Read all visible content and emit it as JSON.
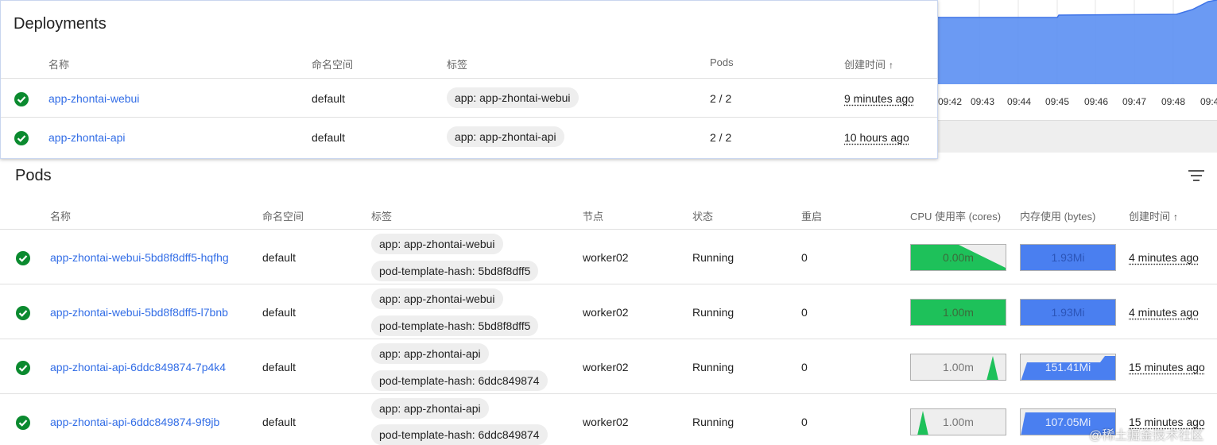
{
  "background_chart": {
    "x_ticks": [
      "09:42",
      "09:43",
      "09:44",
      "09:45",
      "09:46",
      "09:47",
      "09:48",
      "09:4"
    ]
  },
  "deployments": {
    "title": "Deployments",
    "columns": [
      "名称",
      "命名空间",
      "标签",
      "Pods",
      "创建时间"
    ],
    "sort_indicator": "↑",
    "rows": [
      {
        "status": "check-circle-icon",
        "name": "app-zhontai-webui",
        "namespace": "default",
        "label": "app: app-zhontai-webui",
        "pods": "2 / 2",
        "created": "9 minutes ago"
      },
      {
        "status": "check-circle-icon",
        "name": "app-zhontai-api",
        "namespace": "default",
        "label": "app: app-zhontai-api",
        "pods": "2 / 2",
        "created": "10 hours ago"
      }
    ]
  },
  "pods": {
    "title": "Pods",
    "columns": [
      "名称",
      "命名空间",
      "标签",
      "节点",
      "状态",
      "重启",
      "CPU 使用率 (cores)",
      "内存使用 (bytes)",
      "创建时间"
    ],
    "sort_indicator": "↑",
    "rows": [
      {
        "name": "app-zhontai-webui-5bd8f8dff5-hqfhg",
        "namespace": "default",
        "labels": [
          "app: app-zhontai-webui",
          "pod-template-hash: 5bd8f8dff5"
        ],
        "node": "worker02",
        "status": "Running",
        "restarts": "0",
        "cpu": "0.00m",
        "memory": "1.93Mi",
        "created": "4 minutes ago"
      },
      {
        "name": "app-zhontai-webui-5bd8f8dff5-l7bnb",
        "namespace": "default",
        "labels": [
          "app: app-zhontai-webui",
          "pod-template-hash: 5bd8f8dff5"
        ],
        "node": "worker02",
        "status": "Running",
        "restarts": "0",
        "cpu": "1.00m",
        "memory": "1.93Mi",
        "created": "4 minutes ago"
      },
      {
        "name": "app-zhontai-api-6ddc849874-7p4k4",
        "namespace": "default",
        "labels": [
          "app: app-zhontai-api",
          "pod-template-hash: 6ddc849874"
        ],
        "node": "worker02",
        "status": "Running",
        "restarts": "0",
        "cpu": "1.00m",
        "memory": "151.41Mi",
        "created": "15 minutes ago"
      },
      {
        "name": "app-zhontai-api-6ddc849874-9f9jb",
        "namespace": "default",
        "labels": [
          "app: app-zhontai-api",
          "pod-template-hash: 6ddc849874"
        ],
        "node": "worker02",
        "status": "Running",
        "restarts": "0",
        "cpu": "1.00m",
        "memory": "107.05Mi",
        "created": "15 minutes ago"
      }
    ]
  },
  "colors": {
    "link": "#326de6",
    "ok": "#0b8a2f",
    "cpu_green": "#1ec15a",
    "mem_blue": "#4a7ff0"
  },
  "watermark": "@稀土掘金技术社区"
}
